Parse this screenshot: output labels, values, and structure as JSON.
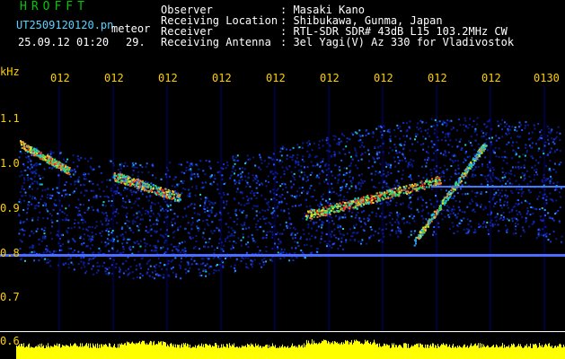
{
  "header": {
    "brand": "HROFFT",
    "filename": "UT2509120120.pn",
    "tag": "meteor",
    "datetime": "25.09.12 01:20",
    "count": "29.",
    "fields": [
      {
        "label": "Observer",
        "value": ": Masaki Kano"
      },
      {
        "label": "Receiving Location",
        "value": ": Shibukawa, Gunma, Japan"
      },
      {
        "label": "Receiver",
        "value": ": RTL-SDR SDR# 43dB L15 103.2MHz CW"
      },
      {
        "label": "Receiving Antenna",
        "value": ": 3el Yagi(V) Az 330 for Vladivostok"
      }
    ]
  },
  "axis": {
    "unit": "kHz",
    "y_ticks": [
      "1.1",
      "1.0",
      "0.9",
      "0.8",
      "0.7",
      "0.6"
    ],
    "x_ticks": [
      "012",
      "012",
      "012",
      "012",
      "012",
      "012",
      "012",
      "012",
      "012",
      "0130"
    ]
  },
  "colors": {
    "background": "#000000",
    "brand": "#00c800",
    "header_text": "#ffffff",
    "filename_text": "#5ad2ff",
    "axis_text": "#ffd000",
    "power_bar": "#ffff00",
    "grid": "#000080",
    "baseline": "#4a6cff"
  }
}
